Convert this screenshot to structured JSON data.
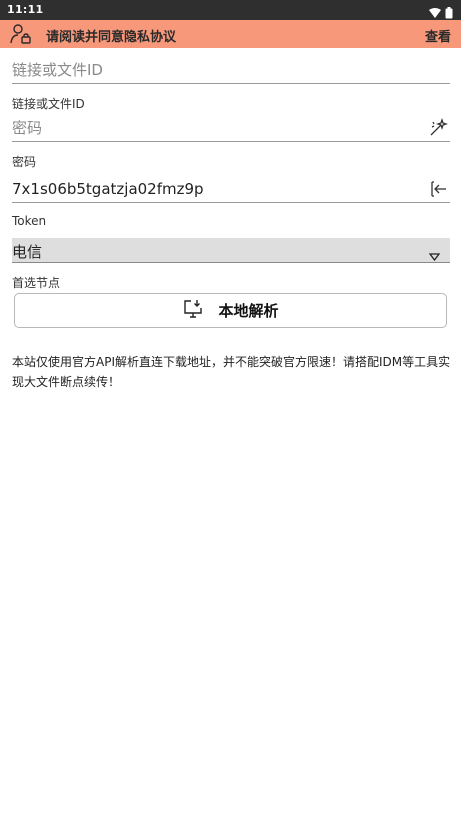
{
  "status_bar": {
    "time": "11:11",
    "icons": [
      "wifi-icon",
      "battery-icon"
    ]
  },
  "notice": {
    "text": "请阅读并同意隐私协议",
    "action": "查看",
    "bg_color": "#f7987a"
  },
  "link_field": {
    "placeholder": "链接或文件ID",
    "value": "",
    "label": "链接或文件ID"
  },
  "password_field": {
    "placeholder": "密码",
    "value": "",
    "label": "密码",
    "trailing_icon": "magic-wand-icon"
  },
  "token_field": {
    "value": "7x1s06b5tgatzja02fmz9p",
    "label": "Token",
    "trailing_icon": "login-icon"
  },
  "node_select": {
    "value": "电信",
    "label": "首选节点"
  },
  "parse_button": {
    "label": "本地解析",
    "icon": "download-monitor-icon"
  },
  "info_text": "本站仅使用官方API解析直连下载地址，并不能突破官方限速！请搭配IDM等工具实现大文件断点续传！"
}
